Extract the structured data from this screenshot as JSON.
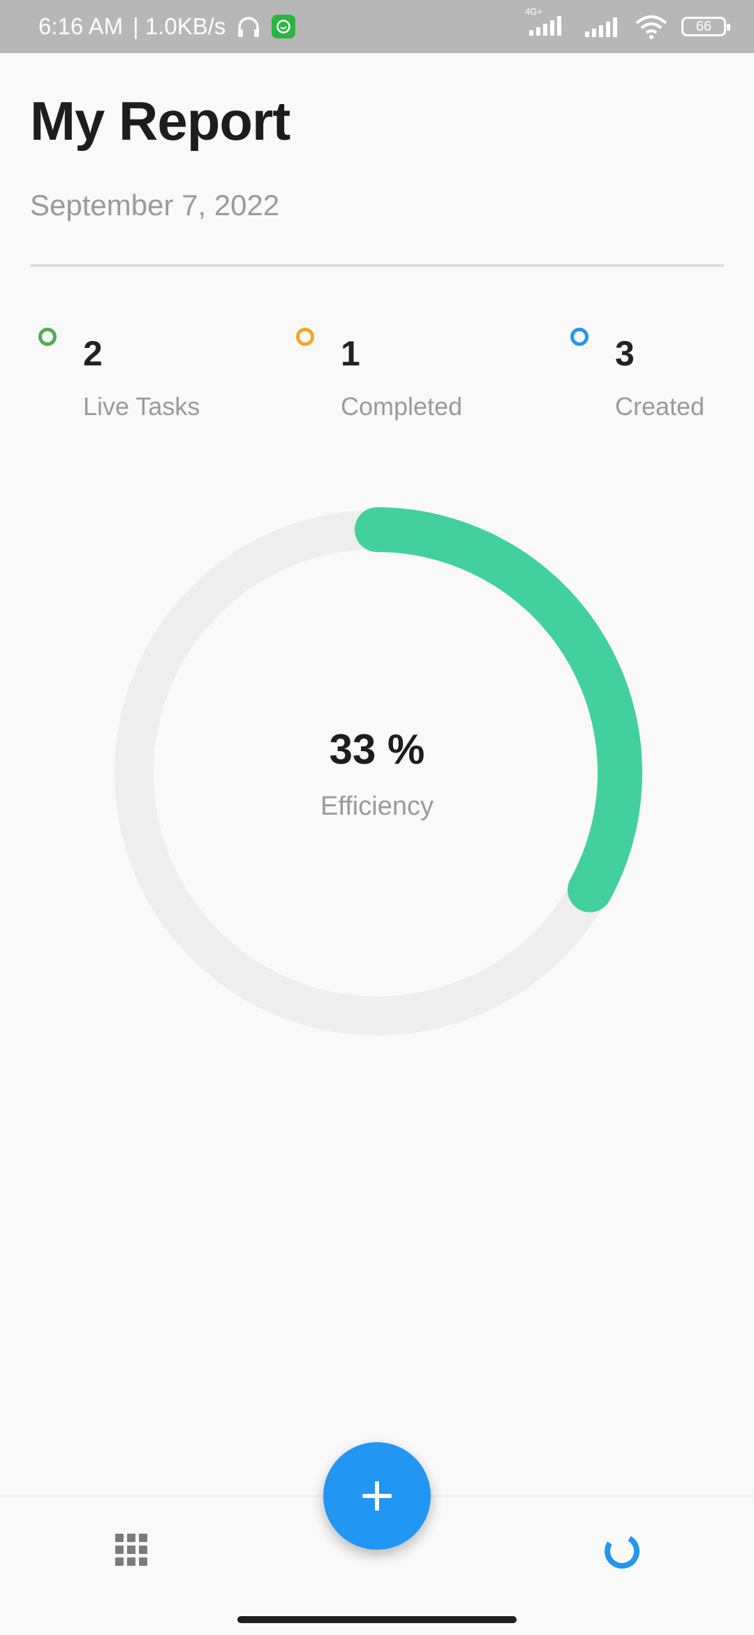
{
  "status_bar": {
    "time": "6:16 AM",
    "network_speed": "| 1.0KB/s",
    "network_type": "4G+",
    "battery": "66",
    "icons": [
      "headset-icon",
      "whatsapp-icon",
      "signal-icon",
      "signal-icon",
      "wifi-icon",
      "battery-icon"
    ]
  },
  "header": {
    "title": "My Report",
    "date": "September 7, 2022"
  },
  "stats": [
    {
      "value": "2",
      "label": "Live Tasks",
      "color": "#4caf50"
    },
    {
      "value": "1",
      "label": "Completed",
      "color": "#f5a623"
    },
    {
      "value": "3",
      "label": "Created",
      "color": "#2196f3"
    }
  ],
  "efficiency": {
    "value_text": "33 %",
    "label": "Efficiency",
    "fraction": 0.33,
    "progress_color": "#42d09e",
    "track_color": "#eeeeee"
  },
  "bottom_nav": {
    "left_icon": "grid-icon",
    "right_icon": "report-ring-icon",
    "fab_icon": "plus-icon",
    "accent": "#2196f3"
  }
}
